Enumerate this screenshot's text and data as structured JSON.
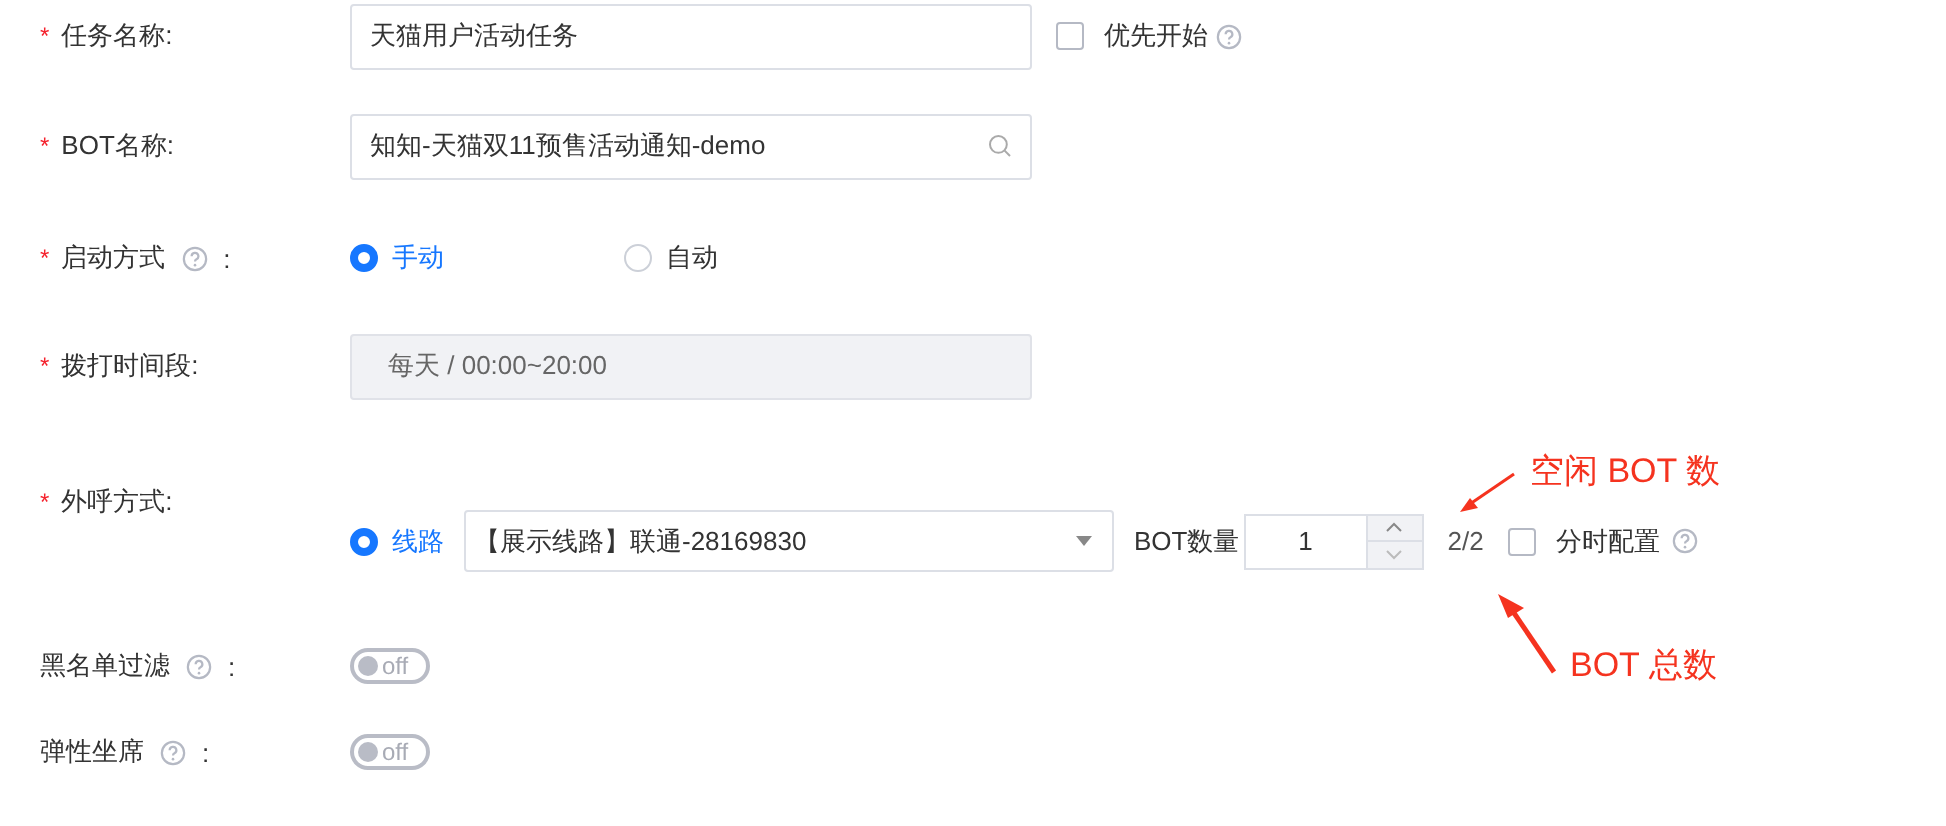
{
  "task_name": {
    "asterisk": "*",
    "label": "任务名称:",
    "value": "天猫用户活动任务"
  },
  "priority": {
    "label": "优先开始",
    "checked": false,
    "help": true
  },
  "bot_name": {
    "asterisk": "*",
    "label": "BOT名称:",
    "value": "知知-天猫双11预售活动通知-demo"
  },
  "start_mode": {
    "asterisk": "*",
    "label": "启动方式",
    "help": true,
    "colon": ":",
    "options": [
      {
        "label": "手动",
        "selected": true
      },
      {
        "label": "自动",
        "selected": false
      }
    ]
  },
  "call_time": {
    "asterisk": "*",
    "label": "拨打时间段:",
    "value": "每天 / 00:00~20:00"
  },
  "outbound": {
    "asterisk": "*",
    "label": "外呼方式:",
    "option": {
      "label": "线路",
      "selected": true
    },
    "line": "【展示线路】联通-28169830",
    "bot_count_label": "BOT数量",
    "bot_count": "1",
    "ratio": "2/2",
    "split": {
      "label": "分时配置",
      "checked": false,
      "help": true
    }
  },
  "toggles": [
    {
      "label": "黑名单过滤",
      "help": true,
      "colon": ":",
      "text": "off",
      "on": false
    },
    {
      "label": "弹性坐席",
      "help": true,
      "colon": ":",
      "text": "off",
      "on": false
    }
  ],
  "annotations": [
    {
      "text": "空闲 BOT 数"
    },
    {
      "text": "BOT 总数"
    }
  ]
}
